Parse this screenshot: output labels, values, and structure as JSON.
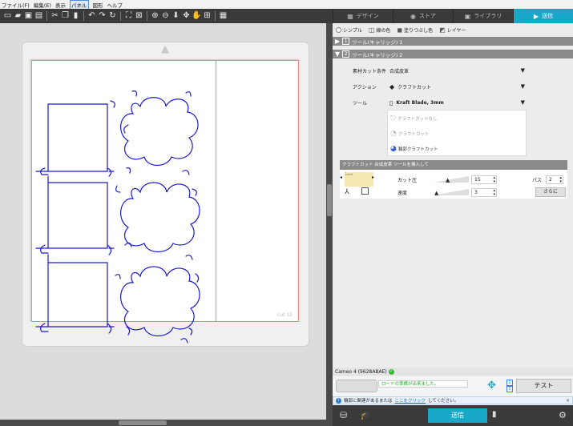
{
  "menu": [
    {
      "label": "ファイル(F)"
    },
    {
      "label": "編集(E)"
    },
    {
      "label": "表示"
    },
    {
      "label": "パネル"
    },
    {
      "label": "図形"
    },
    {
      "label": "ヘルプ"
    }
  ],
  "tabs": [
    {
      "label": "デザイン",
      "icon": "grid-icon"
    },
    {
      "label": "ストア",
      "icon": "store-icon"
    },
    {
      "label": "ライブラリ",
      "icon": "library-icon"
    },
    {
      "label": "送信",
      "icon": "send-icon"
    }
  ],
  "canvas": {
    "mat_label": "cut 12"
  },
  "panel": {
    "modes": [
      "シンプル",
      "線の色",
      "塗りつぶし色",
      "レイヤー"
    ],
    "tool1": {
      "num": "1",
      "label": "ツール(キャリッジ) 1"
    },
    "tool2": {
      "num": "2",
      "label": "ツール(キャリッジ) 2"
    },
    "material_label": "素材カット条件",
    "material_value": "合成皮革",
    "action_label": "アクション",
    "action_value": "クラフトカット",
    "tool_label": "ツール",
    "tool_value": "Kraft Blade, 3mm",
    "tool_options": [
      "クラフトカットなし",
      "クラフトカット",
      "輪郭クラフトカット"
    ],
    "cut_section": "クラフトカット 合成皮革 ツールを挿入して",
    "force_label": "カット圧",
    "force_value": "15",
    "speed_label": "速度",
    "speed_value": "3",
    "pass_label": "パス",
    "pass_value": "2",
    "more_label": "さらに"
  },
  "device": {
    "name": "Cameo 4 (9628ABAE)"
  },
  "load_message": "ロードの準備が出来ました。",
  "page_numbers": [
    "1",
    "2"
  ],
  "test_label": "テスト",
  "info": {
    "text": "輪郭に関連があるまたは",
    "link": "ここをクリック",
    "suffix": "してください。"
  },
  "send_label": "送信",
  "colors": {
    "accent": "#19a8c8",
    "cut_line": "#1a1acc",
    "dark_bar": "#3a3a3a"
  }
}
